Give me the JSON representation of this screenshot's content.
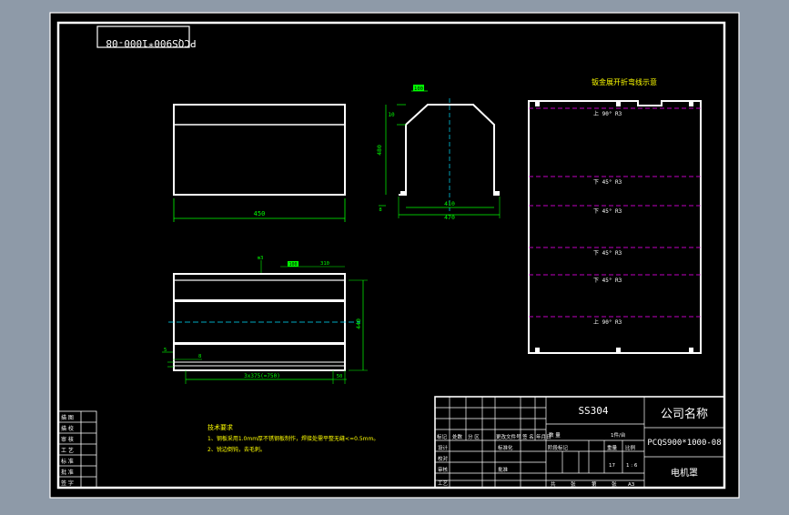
{
  "colors": {
    "viewport_bg": "#8e9aa8",
    "paper": "#000000",
    "outline": "#ffffff",
    "dimension": "#00ff00",
    "centerline": "#00e0ff",
    "bend": "#ff00ff",
    "note_text": "#ffff00"
  },
  "title_strip": {
    "mirrored_code": "PCQS900*1000-08"
  },
  "views": {
    "front_width": "450",
    "side_top_width": "100",
    "side_top_offset": "10",
    "side_height": "480",
    "side_inner_width": "410",
    "side_outer_width": "470",
    "side_foot": "8",
    "plan_hole_label": "m3",
    "plan_slot_1": "100",
    "plan_slot_2": "310",
    "plan_height": "440",
    "plan_left_edge": "5",
    "plan_offset": "8",
    "plan_pitch": "3x375(=750)",
    "plan_end": "50"
  },
  "bend_diagram": {
    "title": "钣金展开折弯线示意",
    "lines": [
      {
        "label": "上  90°  R3"
      },
      {
        "label": "下  45°  R3"
      },
      {
        "label": "下  45°  R3"
      },
      {
        "label": "下  45°  R3"
      },
      {
        "label": "下  45°  R3"
      },
      {
        "label": "上  90°  R3"
      }
    ]
  },
  "tech_notes": {
    "heading": "技术要求",
    "items": [
      "1、钢板采用1.0mm厚不锈钢板制作，焊接处需平整无缝<=0.5mm。",
      "2、锐边倒钝，去毛刺。"
    ]
  },
  "revision_block": [
    "描  图",
    "描  校",
    "审  核",
    "工  艺",
    "标  准",
    "批  准",
    "签  字"
  ],
  "title_block": {
    "material": "SS304",
    "company": "公司名称",
    "drawing_no": "PCQS900*1000-08",
    "part_name": "电机罩",
    "header_row": [
      "标记",
      "处数",
      "分 区",
      "更改文件号",
      "签 名",
      "年月日"
    ],
    "left_rows": [
      "设计",
      "校对",
      "审核",
      "工艺"
    ],
    "mid_rows": [
      "标准化",
      "",
      "批准",
      ""
    ],
    "stage_label": "阶段标记",
    "weight_label": "重量",
    "scale_label": "比例",
    "count_label": "数   量",
    "count_value": "1件/台",
    "scale_values": [
      "17",
      "1 : 6"
    ],
    "sheet_row": [
      "共",
      "张",
      "第",
      "张",
      "A3"
    ]
  }
}
